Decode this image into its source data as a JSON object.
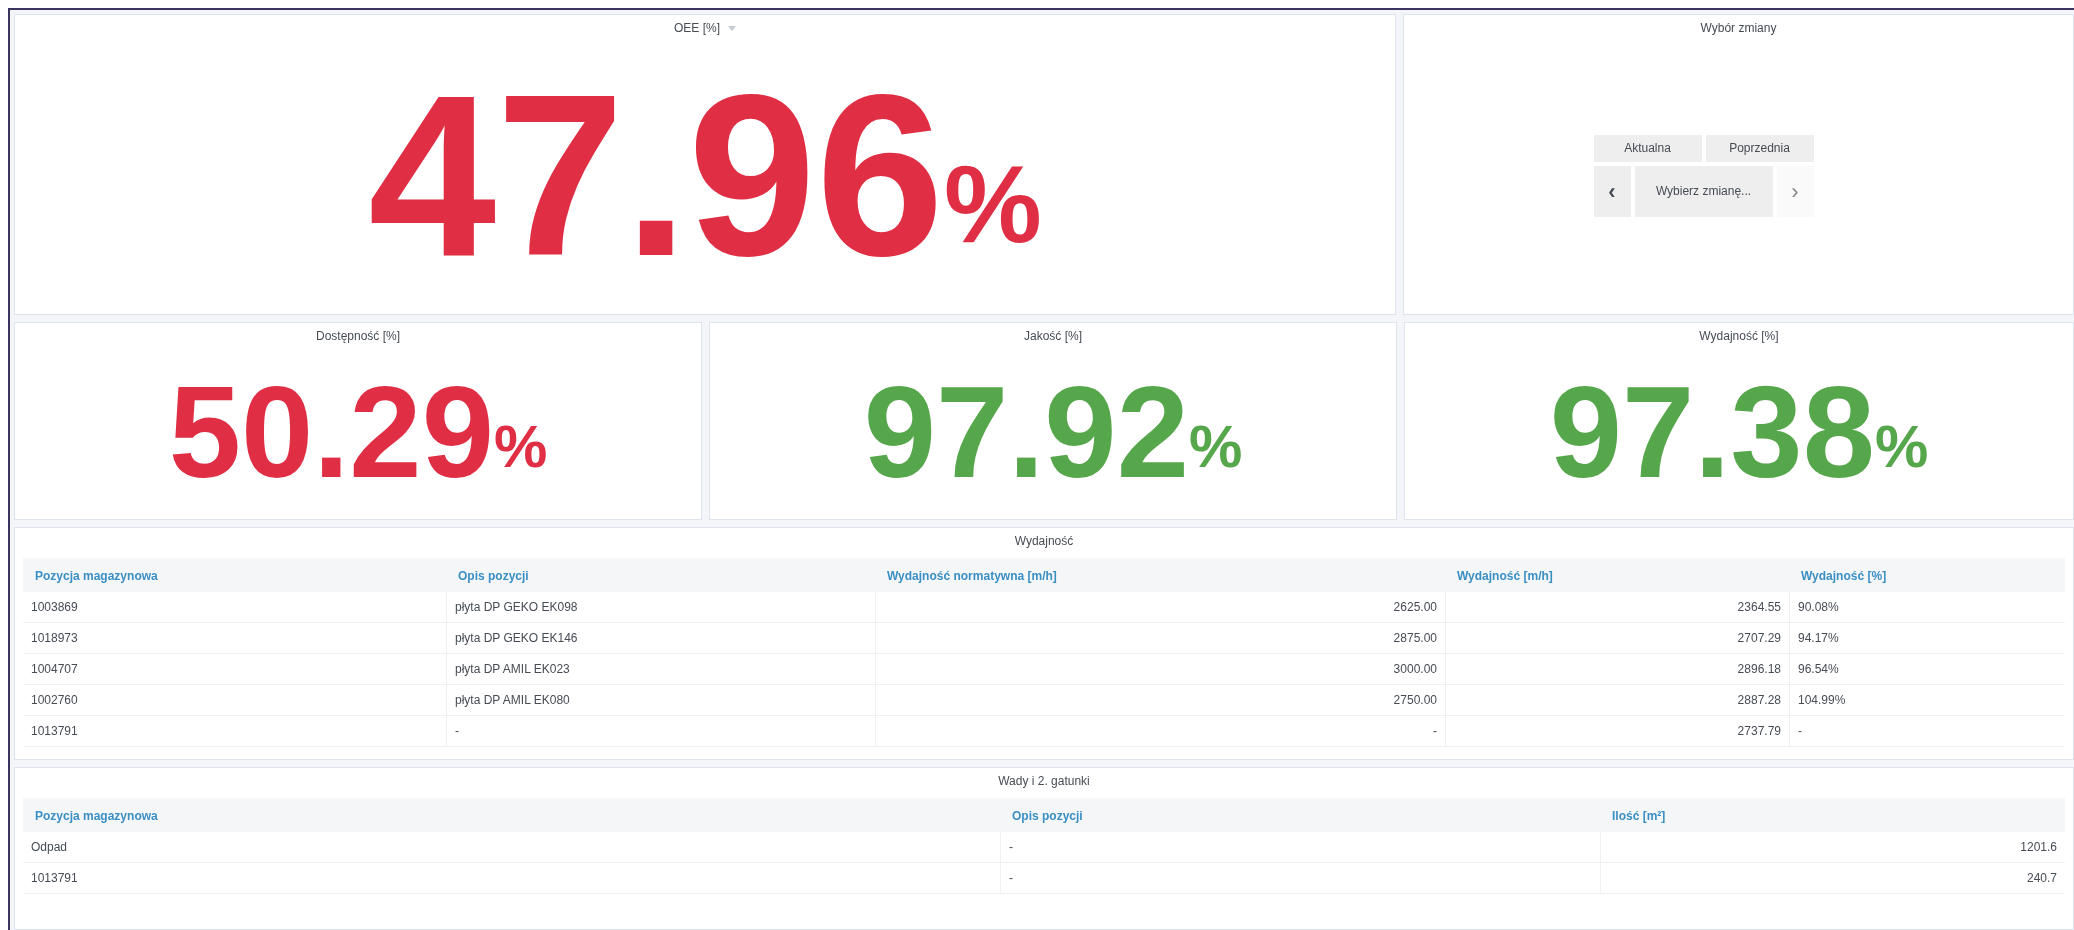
{
  "oee": {
    "title": "OEE [%]",
    "value": "47.96",
    "unit": "%",
    "color": "#e02f44"
  },
  "shift_selector": {
    "title": "Wybór zmiany",
    "buttons": [
      {
        "label": "Aktualna"
      },
      {
        "label": "Poprzednia"
      }
    ],
    "prev": "‹",
    "select": {
      "placeholder": "Wybierz zmianę..."
    },
    "next": "›"
  },
  "metrics": [
    {
      "title": "Dostępność [%]",
      "value": "50.29",
      "unit": "%",
      "color": "#e02f44"
    },
    {
      "title": "Jakość [%]",
      "value": "97.92",
      "unit": "%",
      "color": "#56a64b"
    },
    {
      "title": "Wydajność [%]",
      "value": "97.38",
      "unit": "%",
      "color": "#56a64b"
    }
  ],
  "performance_table": {
    "title": "Wydajność",
    "columns": [
      "Pozycja magazynowa",
      "Opis pozycji",
      "Wydajność normatywna [m/h]",
      "Wydajność [m/h]",
      "Wydajność [%]"
    ],
    "rows": [
      [
        "1003869",
        "płyta DP GEKO EK098",
        "2625.00",
        "2364.55",
        "90.08%"
      ],
      [
        "1018973",
        "płyta DP GEKO EK146",
        "2875.00",
        "2707.29",
        "94.17%"
      ],
      [
        "1004707",
        "płyta DP AMIL EK023",
        "3000.00",
        "2896.18",
        "96.54%"
      ],
      [
        "1002760",
        "płyta DP AMIL EK080",
        "2750.00",
        "2887.28",
        "104.99%"
      ],
      [
        "1013791",
        "-",
        "-",
        "2737.79",
        "-"
      ]
    ]
  },
  "defects_table": {
    "title": "Wady i 2. gatunki",
    "columns": [
      "Pozycja magazynowa",
      "Opis pozycji",
      "Ilość [m²]"
    ],
    "rows": [
      [
        "Odpad",
        "-",
        "1201.6"
      ],
      [
        "1013791",
        "-",
        "240.7"
      ]
    ]
  }
}
